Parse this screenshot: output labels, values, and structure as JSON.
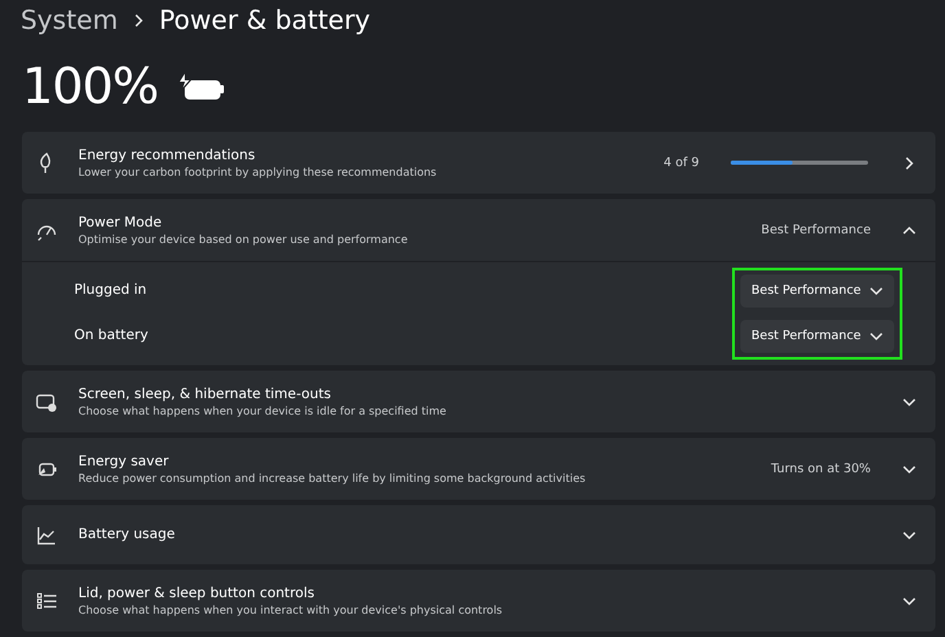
{
  "breadcrumb": {
    "parent": "System",
    "current": "Power & battery"
  },
  "battery": {
    "percent": "100%",
    "charging": true
  },
  "sections": [
    {
      "kind": "link",
      "title": "Energy recommendations",
      "subtitle": "Lower your carbon footprint by applying these recommendations",
      "value": "4 of 9",
      "level": 0.45
    },
    {
      "kind": "expander",
      "title": "Power Mode",
      "subtitle": "Optimise your device based on power use and performance",
      "value": "Best Performance",
      "expanded": true,
      "highlighted": true,
      "options": [
        {
          "label": "Plugged in",
          "value": "Best Performance"
        },
        {
          "label": "On battery",
          "value": "Best Performance"
        }
      ]
    },
    {
      "kind": "expander",
      "title": "Screen, sleep, & hibernate time-outs",
      "subtitle": "Choose what happens when your device is idle for a specified time",
      "expanded": false
    },
    {
      "kind": "expander",
      "title": "Energy saver",
      "subtitle": "Reduce power consumption and increase battery life by limiting some background activities",
      "value": "Turns on at 30%",
      "expanded": false
    },
    {
      "kind": "expander",
      "title": "Battery usage",
      "expanded": false
    },
    {
      "kind": "expander",
      "title": "Lid, power & sleep button controls",
      "subtitle": "Choose what happens when you interact with your device's physical controls",
      "expanded": false
    }
  ]
}
